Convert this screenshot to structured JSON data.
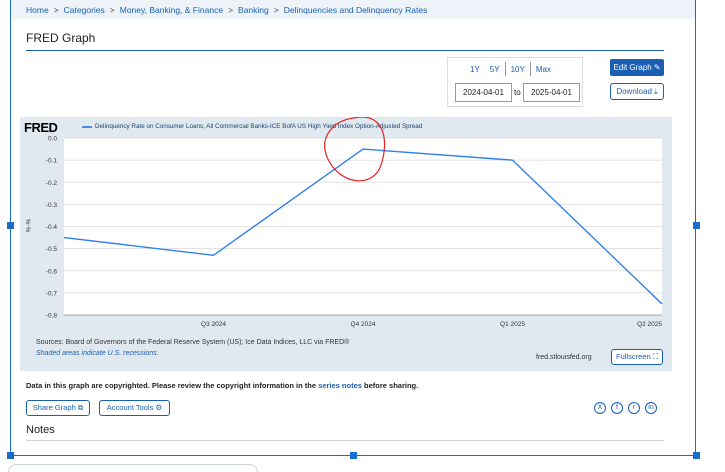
{
  "breadcrumb": {
    "items": [
      "Home",
      "Categories",
      "Money, Banking, & Finance",
      "Banking",
      "Delinquencies and Delinquency Rates"
    ],
    "separator": ">"
  },
  "page": {
    "title": "FRED Graph"
  },
  "range": {
    "buttons": [
      "1Y",
      "5Y",
      "10Y",
      "Max"
    ],
    "start": "2024-04-01",
    "to_label": "to",
    "end": "2025-04-01"
  },
  "actions": {
    "edit": "Edit Graph",
    "download": "Download",
    "fullscreen": "Fullscreen",
    "share": "Share Graph",
    "account": "Account Tools"
  },
  "graph": {
    "logo": "FRED",
    "sources": "Sources: Board of Governors of the Federal Reserve System (US); Ice Data Indices, LLC via FRED®",
    "shaded_note": "Shaded areas indicate U.S. recessions.",
    "site": "fred.stlouisfed.org"
  },
  "copyright": {
    "before": "Data in this graph are copyrighted. Please review the copyright information in the",
    "link": "series notes",
    "after": "before sharing."
  },
  "social": [
    "X",
    "f",
    "r",
    "in"
  ],
  "notes_heading": "Notes",
  "colors": {
    "accent": "#1a5fb4",
    "series": "#2f80ed",
    "annotation": "#e02020",
    "plot_bg": "#e1e9f0"
  },
  "chart_data": {
    "type": "line",
    "title": "",
    "xlabel": "",
    "ylabel": "%-%",
    "ylim": [
      -0.8,
      0.0
    ],
    "yticks": [
      "0.0",
      "-0.1",
      "-0.2",
      "-0.3",
      "-0.4",
      "-0.5",
      "-0.6",
      "-0.7",
      "-0.8"
    ],
    "xticks": [
      {
        "label": "Q3 2024",
        "x": 0.25
      },
      {
        "label": "Q4 2024",
        "x": 0.5
      },
      {
        "label": "Q1 2025",
        "x": 0.75
      },
      {
        "label": "Q2 2025",
        "x": 1.0
      }
    ],
    "series": [
      {
        "name": "Delinquency Rate on Consumer Loans, All Commercial Banks-ICE BofA US High Yield Index Option-Adjusted Spread",
        "x": [
          0.0,
          0.25,
          0.5,
          0.75,
          1.0
        ],
        "y": [
          -0.45,
          -0.53,
          -0.05,
          -0.1,
          -0.75
        ]
      }
    ],
    "grid": true,
    "legend": "top-left"
  }
}
